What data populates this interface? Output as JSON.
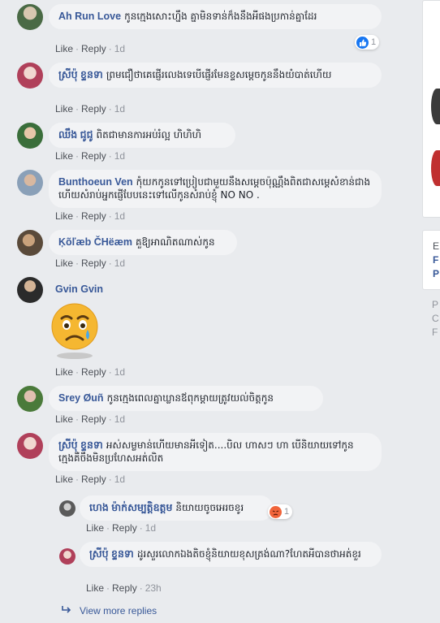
{
  "comments": [
    {
      "author": "Ah Run Love",
      "text": "កូនក្មេងសោះហ្នឹង គ្នាមិនទាន់ក៏ងនឹងអីផងប្រកាន់គ្នាដែរ",
      "like": "Like",
      "reply": "Reply",
      "time": "1d",
      "reaction_count": "1"
    },
    {
      "author": "ស្រីប៉ុ ខ្ទនទា",
      "text": "ព្រមជឿថាគេផ្ញើរលេងទេបើផ្ញើរមែនខ្ទសម្តេចកូននឹងយំបាត់ហើយ",
      "like": "Like",
      "reply": "Reply",
      "time": "1d"
    },
    {
      "author": "ឈឹង ជូជូ",
      "text": "ពិតជាមានការអប់រំល្អ ហិហិហិ",
      "like": "Like",
      "reply": "Reply",
      "time": "1d"
    },
    {
      "author": "Bunthoeun Ven",
      "text": "កុំយកកូនទៅប្រៀបជាមួយនឹងសម្តេចប៉ុណ្ណឹងពិតជាសម្តេសំខាន់ជាងហើយសំរាប់អ្នកផ្ញើបែបនេះទៅលើកូនសំរាប់ខ្ញុំ NO NO .",
      "like": "Like",
      "reply": "Reply",
      "time": "1d"
    },
    {
      "author": "Ķõľæb ČHëæm",
      "text": "គួឱ្យអាណិតណាស់កូន",
      "like": "Like",
      "reply": "Reply",
      "time": "1d"
    },
    {
      "author": "Gvin Gvin",
      "text": "",
      "like": "Like",
      "reply": "Reply",
      "time": "1d"
    },
    {
      "author": "Srey Øuñ",
      "text": "កូនក្មេងពេលគ្នាឃ្លានឪពុកម្តាយត្រូវយល់ចិត្តកូន",
      "like": "Like",
      "reply": "Reply",
      "time": "1d"
    },
    {
      "author": "ស្រីប៉ុ ខ្ទនទា",
      "text": "អស់សម្លមាន់ហើយមានអីទៀត....បិល ហាសៗ ហា បើនិយាយទៅកូនក្មេងគឺចឹងមិនប្រហែសអត់លិត",
      "like": "Like",
      "reply": "Reply",
      "time": "1d"
    }
  ],
  "replies": [
    {
      "author": "ហេង ម៉ាក់សម្បត្តិឧត្តម",
      "text": "និយាយចូចអេរចខូរ",
      "like": "Like",
      "reply": "Reply",
      "time": "1d",
      "reaction_count": "1"
    },
    {
      "author": "ស្រីប៉ុ ខ្ទនទា",
      "text": "ដូរសួរលោកឯងតិចខ្ញុំនិយាយខុសត្រង់ណា?ហែតអីបានថាអត់ខួរ",
      "like": "Like",
      "reply": "Reply",
      "time": "23h"
    }
  ],
  "view_more_replies": "View more replies",
  "sidebar_letters": [
    "E",
    "F",
    "P",
    "P",
    "C",
    "F"
  ],
  "colors": {
    "link": "#385898",
    "bubble": "#f2f3f5",
    "like_blue": "#1877f2",
    "angry": "#f0643a"
  }
}
